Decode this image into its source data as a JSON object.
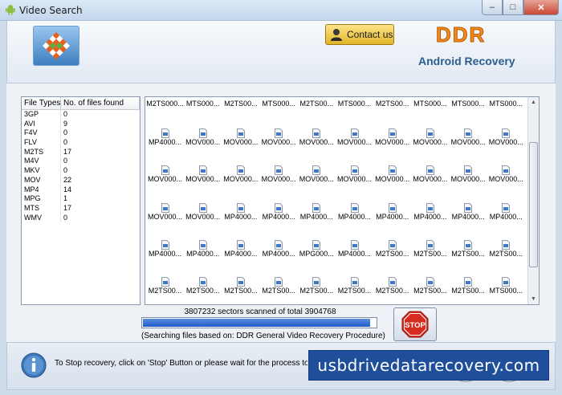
{
  "window": {
    "title": "Video Search"
  },
  "header": {
    "contact_label": "Contact us",
    "brand": "DDR",
    "brand_sub": "Android Recovery"
  },
  "file_types": {
    "headers": [
      "File Types",
      "No. of files found"
    ],
    "rows": [
      {
        "type": "3GP",
        "count": "0"
      },
      {
        "type": "AVI",
        "count": "9"
      },
      {
        "type": "F4V",
        "count": "0"
      },
      {
        "type": "FLV",
        "count": "0"
      },
      {
        "type": "M2TS",
        "count": "17"
      },
      {
        "type": "M4V",
        "count": "0"
      },
      {
        "type": "MKV",
        "count": "0"
      },
      {
        "type": "MOV",
        "count": "22"
      },
      {
        "type": "MP4",
        "count": "14"
      },
      {
        "type": "MPG",
        "count": "1"
      },
      {
        "type": "MTS",
        "count": "17"
      },
      {
        "type": "WMV",
        "count": "0"
      }
    ]
  },
  "files": {
    "rows": [
      [
        "M2TS000...",
        "MTS000...",
        "M2TS00...",
        "MTS000...",
        "M2TS00...",
        "MTS000...",
        "M2TS00...",
        "MTS000...",
        "MTS000...",
        "MTS000..."
      ],
      [
        "MP4000...",
        "MOV000...",
        "MOV000...",
        "MOV000...",
        "MOV000...",
        "MOV000...",
        "MOV000...",
        "MOV000...",
        "MOV000...",
        "MOV000..."
      ],
      [
        "MOV000...",
        "MOV000...",
        "MOV000...",
        "MOV000...",
        "MOV000...",
        "MOV000...",
        "MOV000...",
        "MOV000...",
        "MOV000...",
        "MOV000..."
      ],
      [
        "MOV000...",
        "MOV000...",
        "MP4000...",
        "MP4000...",
        "MP4000...",
        "MP4000...",
        "MP4000...",
        "MP4000...",
        "MP4000...",
        "MP4000..."
      ],
      [
        "MP4000...",
        "MP4000...",
        "MP4000...",
        "MP4000...",
        "MPG000...",
        "MP4000...",
        "M2TS00...",
        "M2TS00...",
        "M2TS00...",
        "M2TS00..."
      ],
      [
        "M2TS00...",
        "M2TS00...",
        "M2TS00...",
        "M2TS00...",
        "M2TS00...",
        "M2TS00...",
        "M2TS00...",
        "M2TS00...",
        "M2TS00...",
        "MTS000..."
      ]
    ]
  },
  "progress": {
    "sectors_text": "3807232 sectors scanned of total 3904768",
    "fraction": 0.975,
    "searching_text": "(Searching files based on:  DDR General Video Recovery Procedure)",
    "stop_label": "STOP"
  },
  "footer": {
    "info_text": "To Stop recovery, click on 'Stop' Button or please wait for the process to be completed.",
    "watermark": "usbdrivedatarecovery.com"
  },
  "colors": {
    "brand": "#f28a1c",
    "progress": "#1f5cc9",
    "stop": "#d62b1e",
    "watermark_bg": "#1f4f9a"
  }
}
